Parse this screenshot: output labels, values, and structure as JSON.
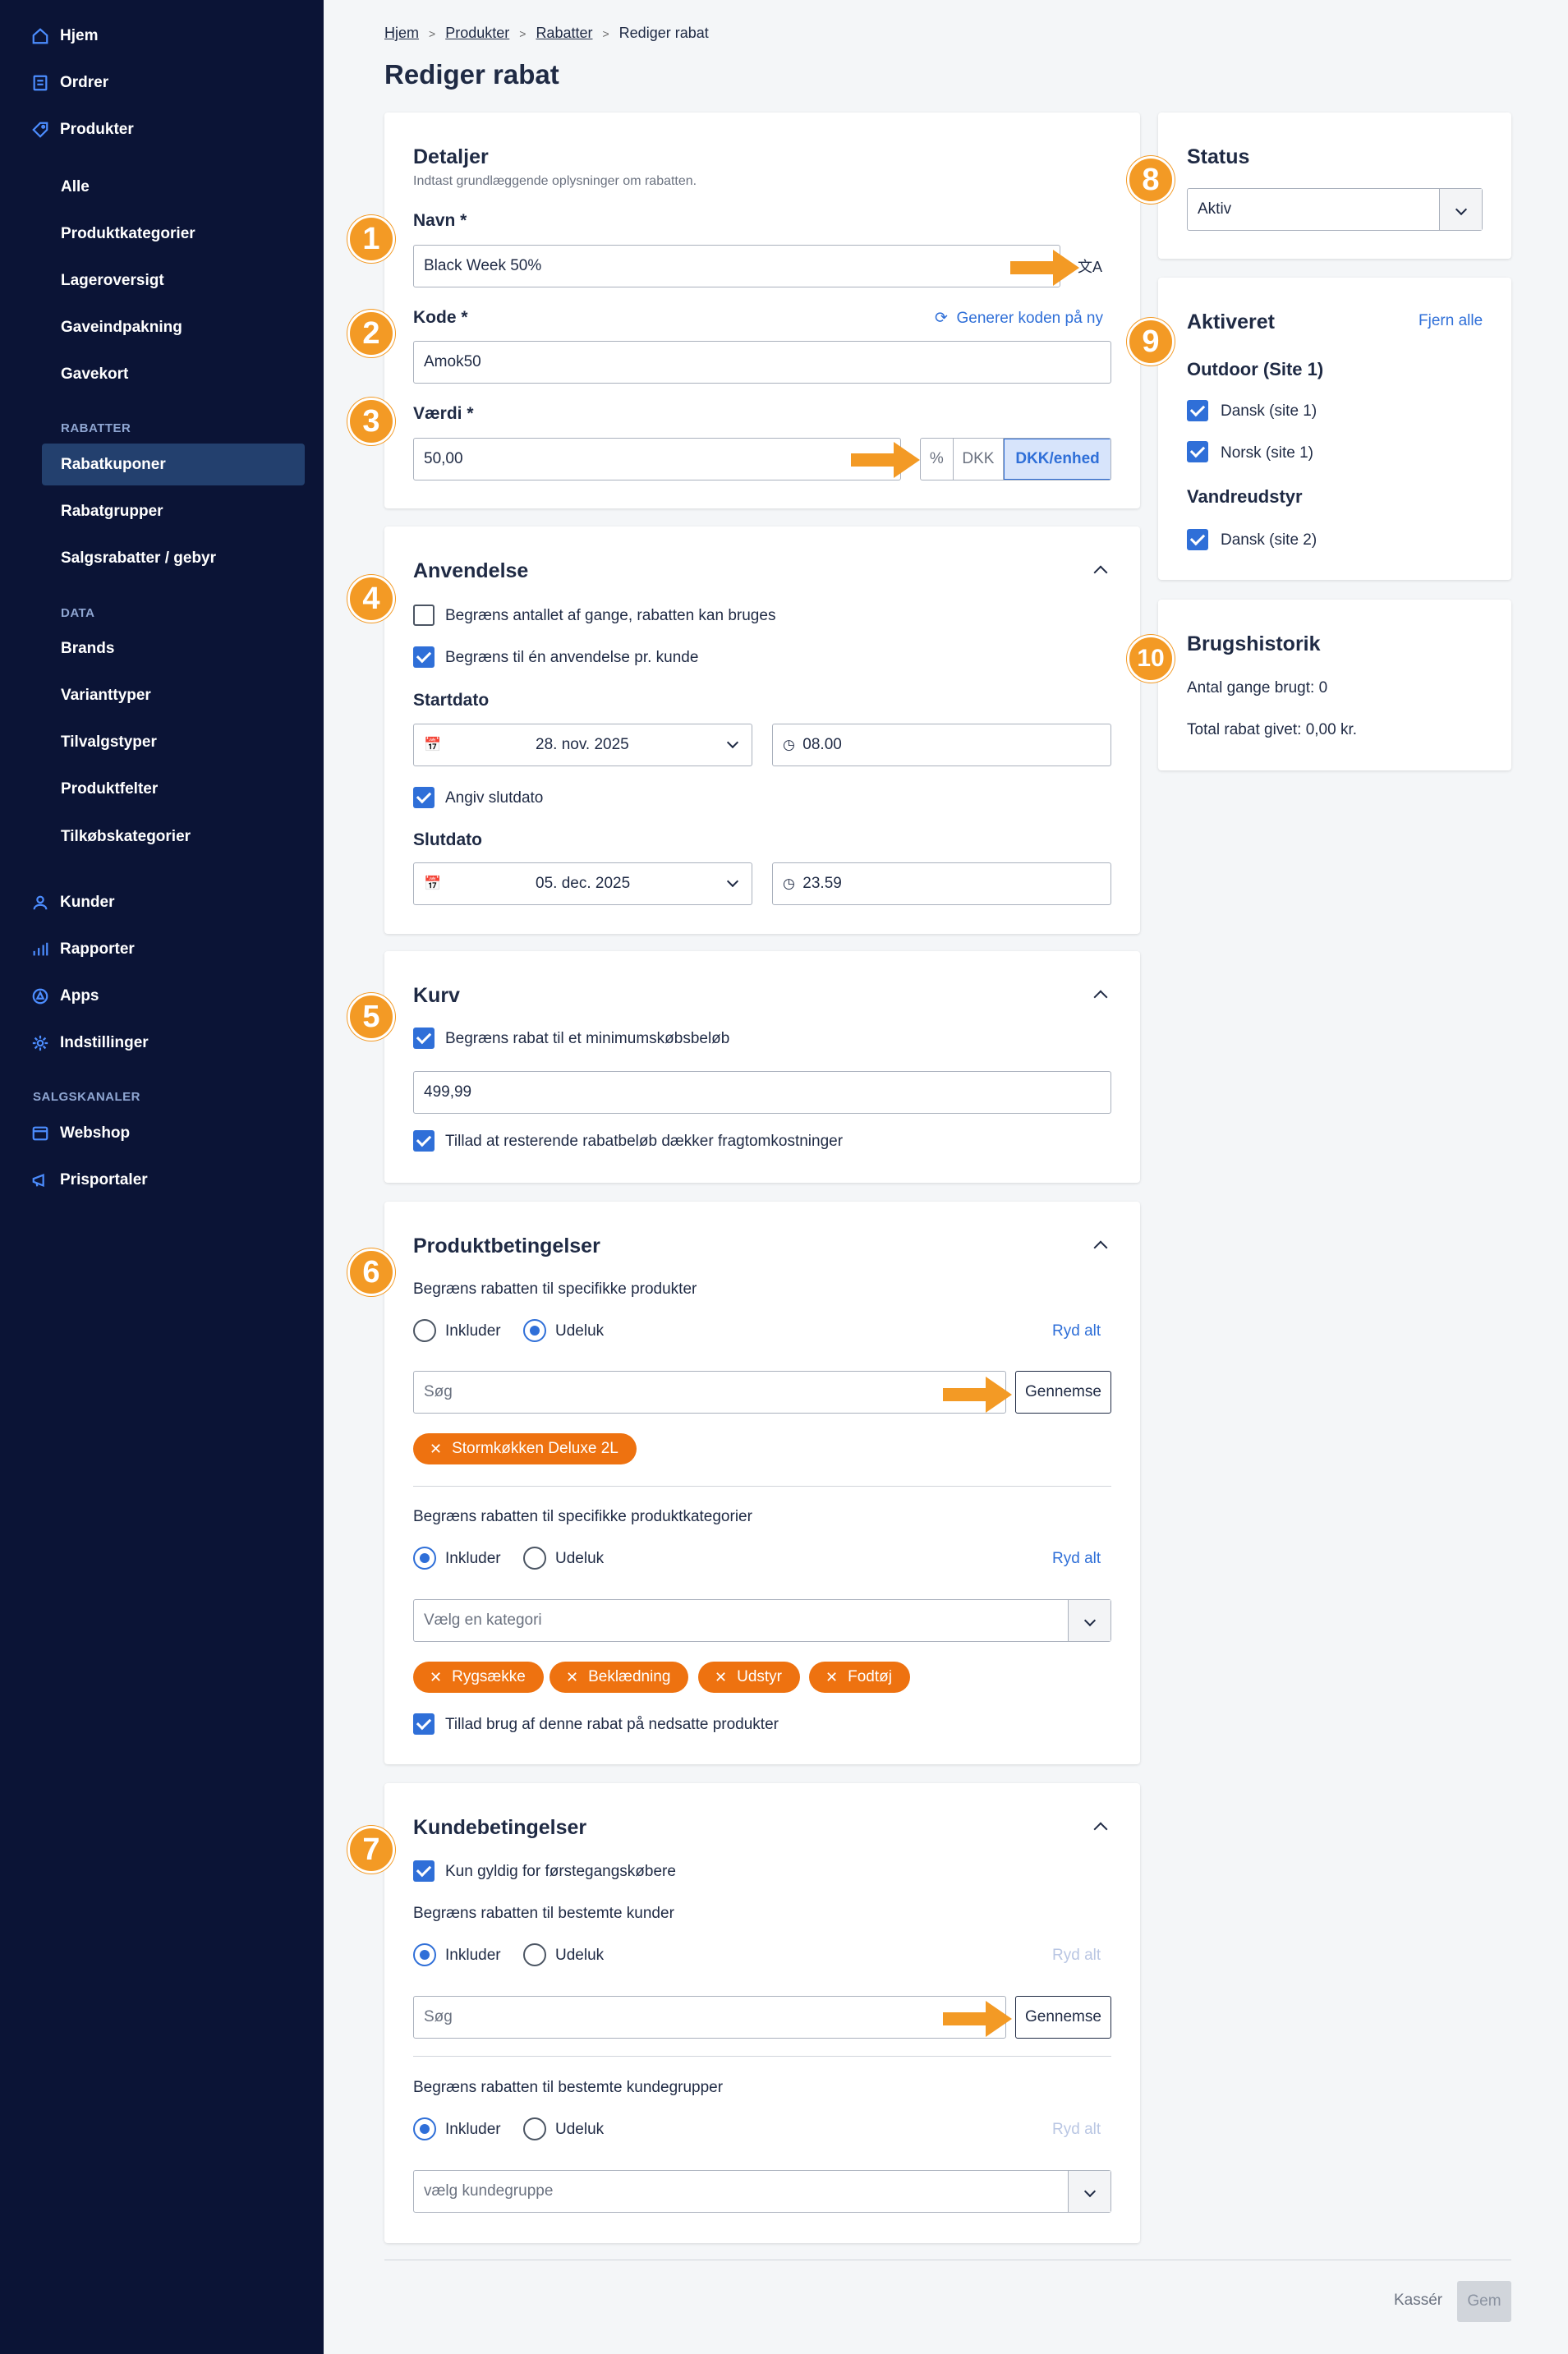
{
  "sidebar": {
    "top": [
      {
        "label": "Hjem",
        "icon": "home-icon"
      },
      {
        "label": "Ordrer",
        "icon": "orders-icon"
      },
      {
        "label": "Produkter",
        "icon": "tag-icon"
      }
    ],
    "produkter_sub": [
      "Alle",
      "Produktkategorier",
      "Lageroversigt",
      "Gaveindpakning",
      "Gavekort"
    ],
    "rabatter_heading": "RABATTER",
    "rabatter_sub": [
      "Rabatkuponer",
      "Rabatgrupper",
      "Salgsrabatter / gebyr"
    ],
    "data_heading": "DATA",
    "data_sub": [
      "Brands",
      "Varianttyper",
      "Tilvalgstyper",
      "Produktfelter",
      "Tilkøbskategorier"
    ],
    "bottom": [
      {
        "label": "Kunder",
        "icon": "user-icon"
      },
      {
        "label": "Rapporter",
        "icon": "chart-icon"
      },
      {
        "label": "Apps",
        "icon": "apps-icon"
      },
      {
        "label": "Indstillinger",
        "icon": "gear-icon"
      }
    ],
    "salgskanaler_heading": "SALGSKANALER",
    "channels": [
      {
        "label": "Webshop",
        "icon": "store-icon"
      },
      {
        "label": "Prisportaler",
        "icon": "megaphone-icon"
      }
    ]
  },
  "breadcrumb": [
    "Hjem",
    "Produkter",
    "Rabatter",
    "Rediger rabat"
  ],
  "page_title": "Rediger rabat",
  "details": {
    "title": "Detaljer",
    "subtitle": "Indtast grundlæggende oplysninger om rabatten.",
    "name_label": "Navn *",
    "name_value": "Black Week 50%",
    "code_label": "Kode *",
    "regenerate_label": "Generer koden på ny",
    "code_value": "Amok50",
    "value_label": "Værdi *",
    "value_value": "50,00",
    "units": [
      "%",
      "DKK",
      "DKK/enhed"
    ]
  },
  "usage": {
    "title": "Anvendelse",
    "limit_times": "Begræns antallet af gange, rabatten kan bruges",
    "limit_once": "Begræns til én anvendelse pr. kunde",
    "start_label": "Startdato",
    "start_date": "28. nov. 2025",
    "start_time": "08.00",
    "set_end": "Angiv slutdato",
    "end_label": "Slutdato",
    "end_date": "05. dec. 2025",
    "end_time": "23.59"
  },
  "cart": {
    "title": "Kurv",
    "min_limit": "Begræns rabat til et minimumskøbsbeløb",
    "min_value": "499,99",
    "allow_shipping": "Tillad at resterende rabatbeløb dækker fragtomkostninger"
  },
  "product_conditions": {
    "title": "Produktbetingelser",
    "limit_products": "Begræns rabatten til specifikke produkter",
    "include": "Inkluder",
    "exclude": "Udeluk",
    "clear_all": "Ryd alt",
    "search_placeholder": "Søg",
    "browse": "Gennemse",
    "product_chips": [
      "Stormkøkken Deluxe 2L"
    ],
    "limit_categories": "Begræns rabatten til specifikke produktkategorier",
    "category_placeholder": "Vælg en kategori",
    "category_chips": [
      "Rygsække",
      "Beklædning",
      "Udstyr",
      "Fodtøj"
    ],
    "allow_discounted": "Tillad brug af denne rabat på nedsatte produkter"
  },
  "customer_conditions": {
    "title": "Kundebetingelser",
    "first_time": "Kun gyldig for førstegangskøbere",
    "limit_customers": "Begræns rabatten til bestemte kunder",
    "include": "Inkluder",
    "exclude": "Udeluk",
    "clear_all": "Ryd alt",
    "search_placeholder": "Søg",
    "browse": "Gennemse",
    "limit_groups": "Begræns rabatten til bestemte kundegrupper",
    "group_placeholder": "vælg kundegruppe"
  },
  "status": {
    "title": "Status",
    "value": "Aktiv"
  },
  "activated": {
    "title": "Aktiveret",
    "remove_all": "Fjern alle",
    "groups": [
      {
        "name": "Outdoor (Site 1)",
        "items": [
          "Dansk (site 1)",
          "Norsk (site 1)"
        ]
      },
      {
        "name": "Vandreudstyr",
        "items": [
          "Dansk (site 2)"
        ]
      }
    ]
  },
  "history": {
    "title": "Brugshistorik",
    "times_used": "Antal gange brugt: 0",
    "total_given": "Total rabat givet: 0,00 kr."
  },
  "footer": {
    "cancel": "Kassér",
    "save": "Gem"
  },
  "annotations": [
    "1",
    "2",
    "3",
    "4",
    "5",
    "6",
    "7",
    "8",
    "9",
    "10"
  ],
  "colors": {
    "sidebar_bg": "#0b1436",
    "accent_blue": "#2f6fd8",
    "chip_orange": "#ee7210",
    "badge_orange": "#f39a25"
  }
}
